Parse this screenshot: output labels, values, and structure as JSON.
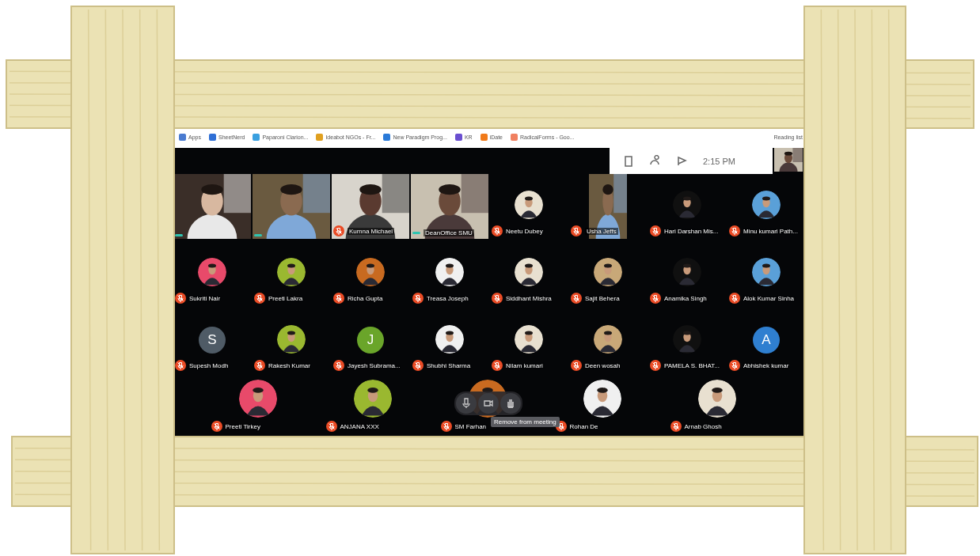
{
  "bookmarks_bar": {
    "items": [
      {
        "label": "Apps",
        "color": "#4a7bd0"
      },
      {
        "label": "SheetNerd",
        "color": "#2f6fd6"
      },
      {
        "label": "Paparoni Clarion...",
        "color": "#3aa0e0"
      },
      {
        "label": "Ideabot NGOs - Fr...",
        "color": "#e0a020"
      },
      {
        "label": "New Paradigm Prog...",
        "color": "#2a7ad8"
      },
      {
        "label": "KR",
        "color": "#6a4fd0"
      },
      {
        "label": "iDate",
        "color": "#f07a1a"
      },
      {
        "label": "RadicalForms - Goo...",
        "color": "#f08060"
      }
    ],
    "reading_list": "Reading list"
  },
  "meeting": {
    "status_panel": {
      "time": "2:15 PM"
    },
    "rows": [
      [
        {
          "kind": "video",
          "muted": false
        },
        {
          "kind": "video",
          "muted": false
        },
        {
          "kind": "video",
          "name": "Kumna Michael",
          "muted": true
        },
        {
          "kind": "video",
          "name": "DeanOffice SMU",
          "muted": false
        },
        {
          "kind": "avatar",
          "name": "Neetu Dubey",
          "muted": true
        },
        {
          "kind": "video",
          "name": "Usha Jeffs",
          "muted": true
        },
        {
          "kind": "avatar",
          "name": "Hari Darshan Mis...",
          "muted": true
        },
        {
          "kind": "avatar",
          "name": "Minu kumari Path...",
          "muted": true
        }
      ],
      [
        {
          "kind": "avatar",
          "name": "Sukriti Nair",
          "muted": true
        },
        {
          "kind": "avatar",
          "name": "Preeti Lakra",
          "muted": true
        },
        {
          "kind": "avatar",
          "name": "Richa Gupta",
          "muted": true
        },
        {
          "kind": "avatar",
          "name": "Treasa Joseph",
          "muted": true
        },
        {
          "kind": "avatar",
          "name": "Siddhant Mishra",
          "muted": true
        },
        {
          "kind": "avatar",
          "name": "Sajit Behera",
          "muted": true
        },
        {
          "kind": "avatar",
          "name": "Anamika Singh",
          "muted": true
        },
        {
          "kind": "avatar",
          "name": "Alok Kumar Sinha",
          "muted": true
        }
      ],
      [
        {
          "kind": "letter",
          "letter": "S",
          "color": "#4f5b66",
          "name": "Supesh Modh",
          "muted": true
        },
        {
          "kind": "avatar",
          "name": "Rakesh Kumar",
          "muted": true
        },
        {
          "kind": "letter",
          "letter": "J",
          "color": "#6aa52a",
          "name": "Jayesh Subrama...",
          "muted": true
        },
        {
          "kind": "avatar",
          "name": "Shubhi Sharma",
          "muted": true
        },
        {
          "kind": "avatar",
          "name": "Nilam kumari",
          "muted": true
        },
        {
          "kind": "avatar",
          "name": "Deen wosah",
          "muted": true
        },
        {
          "kind": "avatar",
          "name": "PAMELA S. BHAT...",
          "muted": true
        },
        {
          "kind": "letter",
          "letter": "A",
          "color": "#2f7fd0",
          "name": "Abhishek kumar",
          "muted": true
        }
      ]
    ],
    "bottom_row": [
      {
        "kind": "avatar",
        "name": "Preeti Tirkey",
        "muted": true
      },
      {
        "kind": "avatar",
        "name": "ANJANA XXX",
        "muted": true
      },
      {
        "kind": "avatar",
        "name": "SM Farhan",
        "muted": true
      },
      {
        "kind": "avatar",
        "name": "Rohan De",
        "muted": true
      },
      {
        "kind": "avatar",
        "name": "Arnab Ghosh",
        "muted": true
      }
    ],
    "controls": {
      "tooltip": "Remove from meeting"
    }
  }
}
